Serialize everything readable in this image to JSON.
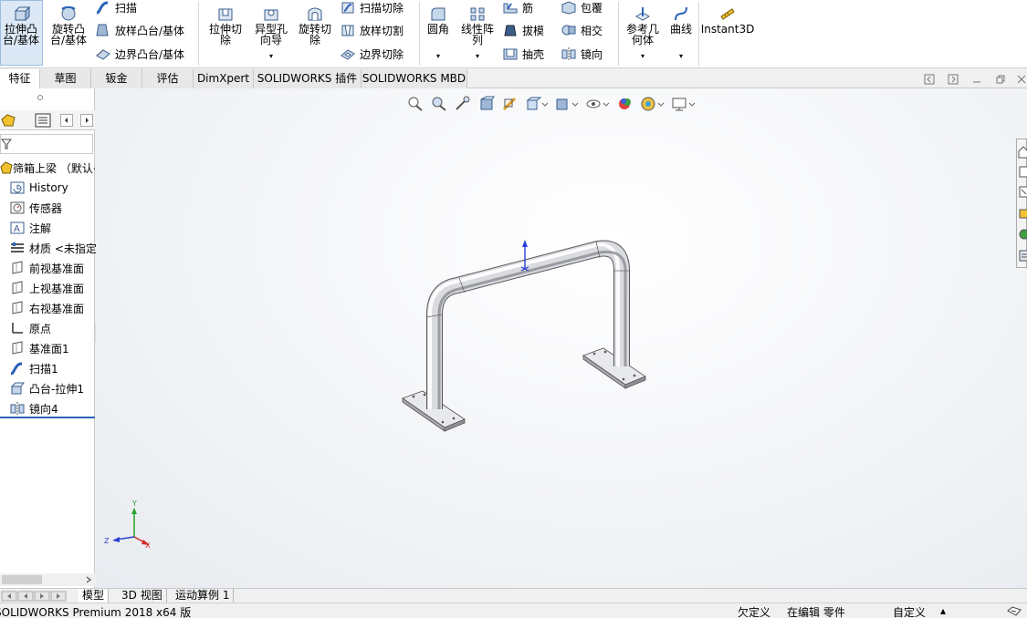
{
  "ribbon": {
    "extrude_boss": "拉伸凸\n台/基体",
    "revolve_boss": "旋转凸\n台/基体",
    "sweep": "扫描",
    "loft_boss": "放样凸台/基体",
    "boundary_boss": "边界凸台/基体",
    "extrude_cut": "拉伸切\n除",
    "hole_wizard": "异型孔\n向导",
    "revolve_cut": "旋转切\n除",
    "sweep_cut": "扫描切除",
    "loft_cut": "放样切割",
    "boundary_cut": "边界切除",
    "fillet": "圆角",
    "linear_pattern": "线性阵\n列",
    "rib": "筋",
    "draft": "拔模",
    "shell": "抽壳",
    "wrap": "包覆",
    "intersect": "相交",
    "mirror": "镜向",
    "ref_geometry": "参考几\n何体",
    "curves": "曲线",
    "instant3d": "Instant3D",
    "dropdown": "▾"
  },
  "tabs": [
    "特征",
    "草图",
    "钣金",
    "评估",
    "DimXpert",
    "SOLIDWORKS 插件",
    "SOLIDWORKS MBD"
  ],
  "tree": {
    "part": "筛箱上梁 （默认<",
    "items": [
      {
        "label": "History",
        "icon": "history-icon"
      },
      {
        "label": "传感器",
        "icon": "sensor-icon"
      },
      {
        "label": "注解",
        "icon": "annotation-icon"
      },
      {
        "label": "材质 <未指定",
        "icon": "material-icon"
      },
      {
        "label": "前视基准面",
        "icon": "plane-icon"
      },
      {
        "label": "上视基准面",
        "icon": "plane-icon"
      },
      {
        "label": "右视基准面",
        "icon": "plane-icon"
      },
      {
        "label": "原点",
        "icon": "origin-icon"
      },
      {
        "label": "基准面1",
        "icon": "plane-icon"
      },
      {
        "label": "扫描1",
        "icon": "sweep-icon"
      },
      {
        "label": "凸台-拉伸1",
        "icon": "extrude-icon"
      },
      {
        "label": "镜向4",
        "icon": "mirror-icon"
      }
    ]
  },
  "triad": {
    "x": "X",
    "y": "Y",
    "z": "Z"
  },
  "bottom_tabs": [
    "模型",
    "3D 视图",
    "运动算例 1"
  ],
  "status": {
    "app": "SOLIDWORKS Premium 2018 x64 版",
    "undefined": "欠定义",
    "editing": "在编辑 零件",
    "custom": "自定义",
    "caret": "▴"
  },
  "colors": {
    "accent": "#2a62b8",
    "tree_line": "#2a62b8"
  }
}
